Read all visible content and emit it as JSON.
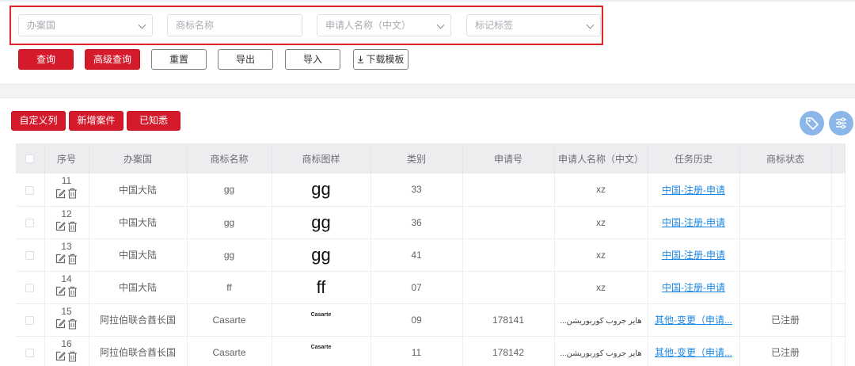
{
  "filters": {
    "office": "办案国",
    "trademark_name": "商标名称",
    "applicant_cn": "申请人名称（中文）",
    "tag": "标记标签"
  },
  "buttons": {
    "search": "查询",
    "advanced": "高级查询",
    "reset": "重置",
    "export": "导出",
    "import": "导入",
    "download_template": "下载模板",
    "custom_columns": "自定义列",
    "new_case": "新增案件",
    "known": "已知悉"
  },
  "icons": {
    "download": "download-icon",
    "tag": "tag-icon",
    "settings": "sliders-icon",
    "edit": "edit-icon",
    "delete": "trash-icon"
  },
  "colors": {
    "accent": "#d41a2b",
    "link": "#1e88e5",
    "highlight_border": "#e2242a"
  },
  "table": {
    "headers": [
      "序号",
      "办案国",
      "商标名称",
      "商标图样",
      "类别",
      "申请号",
      "申请人名称（中文）",
      "任务历史",
      "商标状态"
    ],
    "rows": [
      {
        "no": "11",
        "office": "中国大陆",
        "name": "gg",
        "image": "gg",
        "class": "33",
        "app_no": "",
        "applicant": "xz",
        "history": "中国-注册-申请",
        "status": ""
      },
      {
        "no": "12",
        "office": "中国大陆",
        "name": "gg",
        "image": "gg",
        "class": "36",
        "app_no": "",
        "applicant": "xz",
        "history": "中国-注册-申请",
        "status": ""
      },
      {
        "no": "13",
        "office": "中国大陆",
        "name": "gg",
        "image": "gg",
        "class": "41",
        "app_no": "",
        "applicant": "xz",
        "history": "中国-注册-申请",
        "status": ""
      },
      {
        "no": "14",
        "office": "中国大陆",
        "name": "ff",
        "image": "ff",
        "class": "07",
        "app_no": "",
        "applicant": "xz",
        "history": "中国-注册-申请",
        "status": ""
      },
      {
        "no": "15",
        "office": "阿拉伯联合酋长国",
        "name": "Casarte",
        "image": "Casarte",
        "class": "09",
        "app_no": "178141",
        "applicant": "...هاير جروب كوربوريشن",
        "history": "其他-变更（申请...",
        "status": "已注册"
      },
      {
        "no": "16",
        "office": "阿拉伯联合酋长国",
        "name": "Casarte",
        "image": "Casarte",
        "class": "11",
        "app_no": "178142",
        "applicant": "...هاير جروب كوربوريشن",
        "history": "其他-变更（申请...",
        "status": "已注册"
      }
    ]
  }
}
